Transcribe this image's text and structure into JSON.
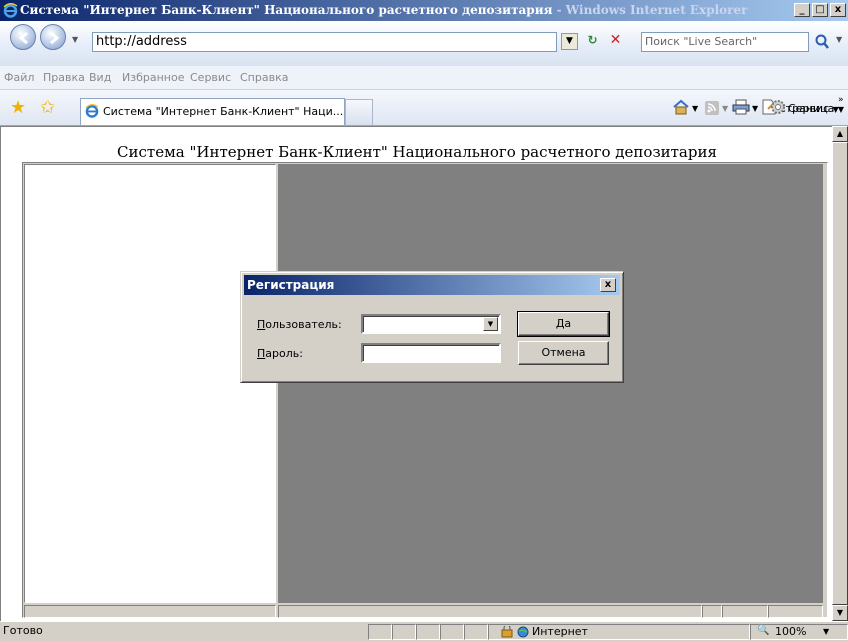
{
  "window": {
    "title_main": "Система \"Интернет Банк-Клиент\" Национального расчетного депозитария",
    "title_suffix": " - Windows Internet Explorer",
    "min_label": "_",
    "max_label": "□",
    "close_label": "x"
  },
  "address_bar": {
    "url": "http://address",
    "search_placeholder": "Поиск \"Live Search\""
  },
  "menu": [
    "Файл",
    "Правка",
    "Вид",
    "Избранное",
    "Сервис",
    "Справка"
  ],
  "tab": {
    "label": "Система \"Интернет Банк-Клиент\" Наци..."
  },
  "command_bar": {
    "page_label": "Страница",
    "tools_label": "Сервис"
  },
  "page": {
    "heading": "Система \"Интернет Банк-Клиент\" Национального расчетного депозитария"
  },
  "dialog": {
    "title": "Регистрация",
    "close_label": "x",
    "user_label_accel": "П",
    "user_label_rest": "ользователь:",
    "password_label_accel": "П",
    "password_label_rest": "ароль:",
    "user_value": "",
    "password_value": "",
    "ok_label": "Да",
    "cancel_label": "Отмена"
  },
  "status_bar": {
    "status_text": "Готово",
    "zone_text": "Интернет",
    "zoom_text": "100%"
  },
  "colors": {
    "titlebar_start": "#0a246a",
    "titlebar_end": "#a6caf0",
    "frame_gray": "#808080"
  }
}
